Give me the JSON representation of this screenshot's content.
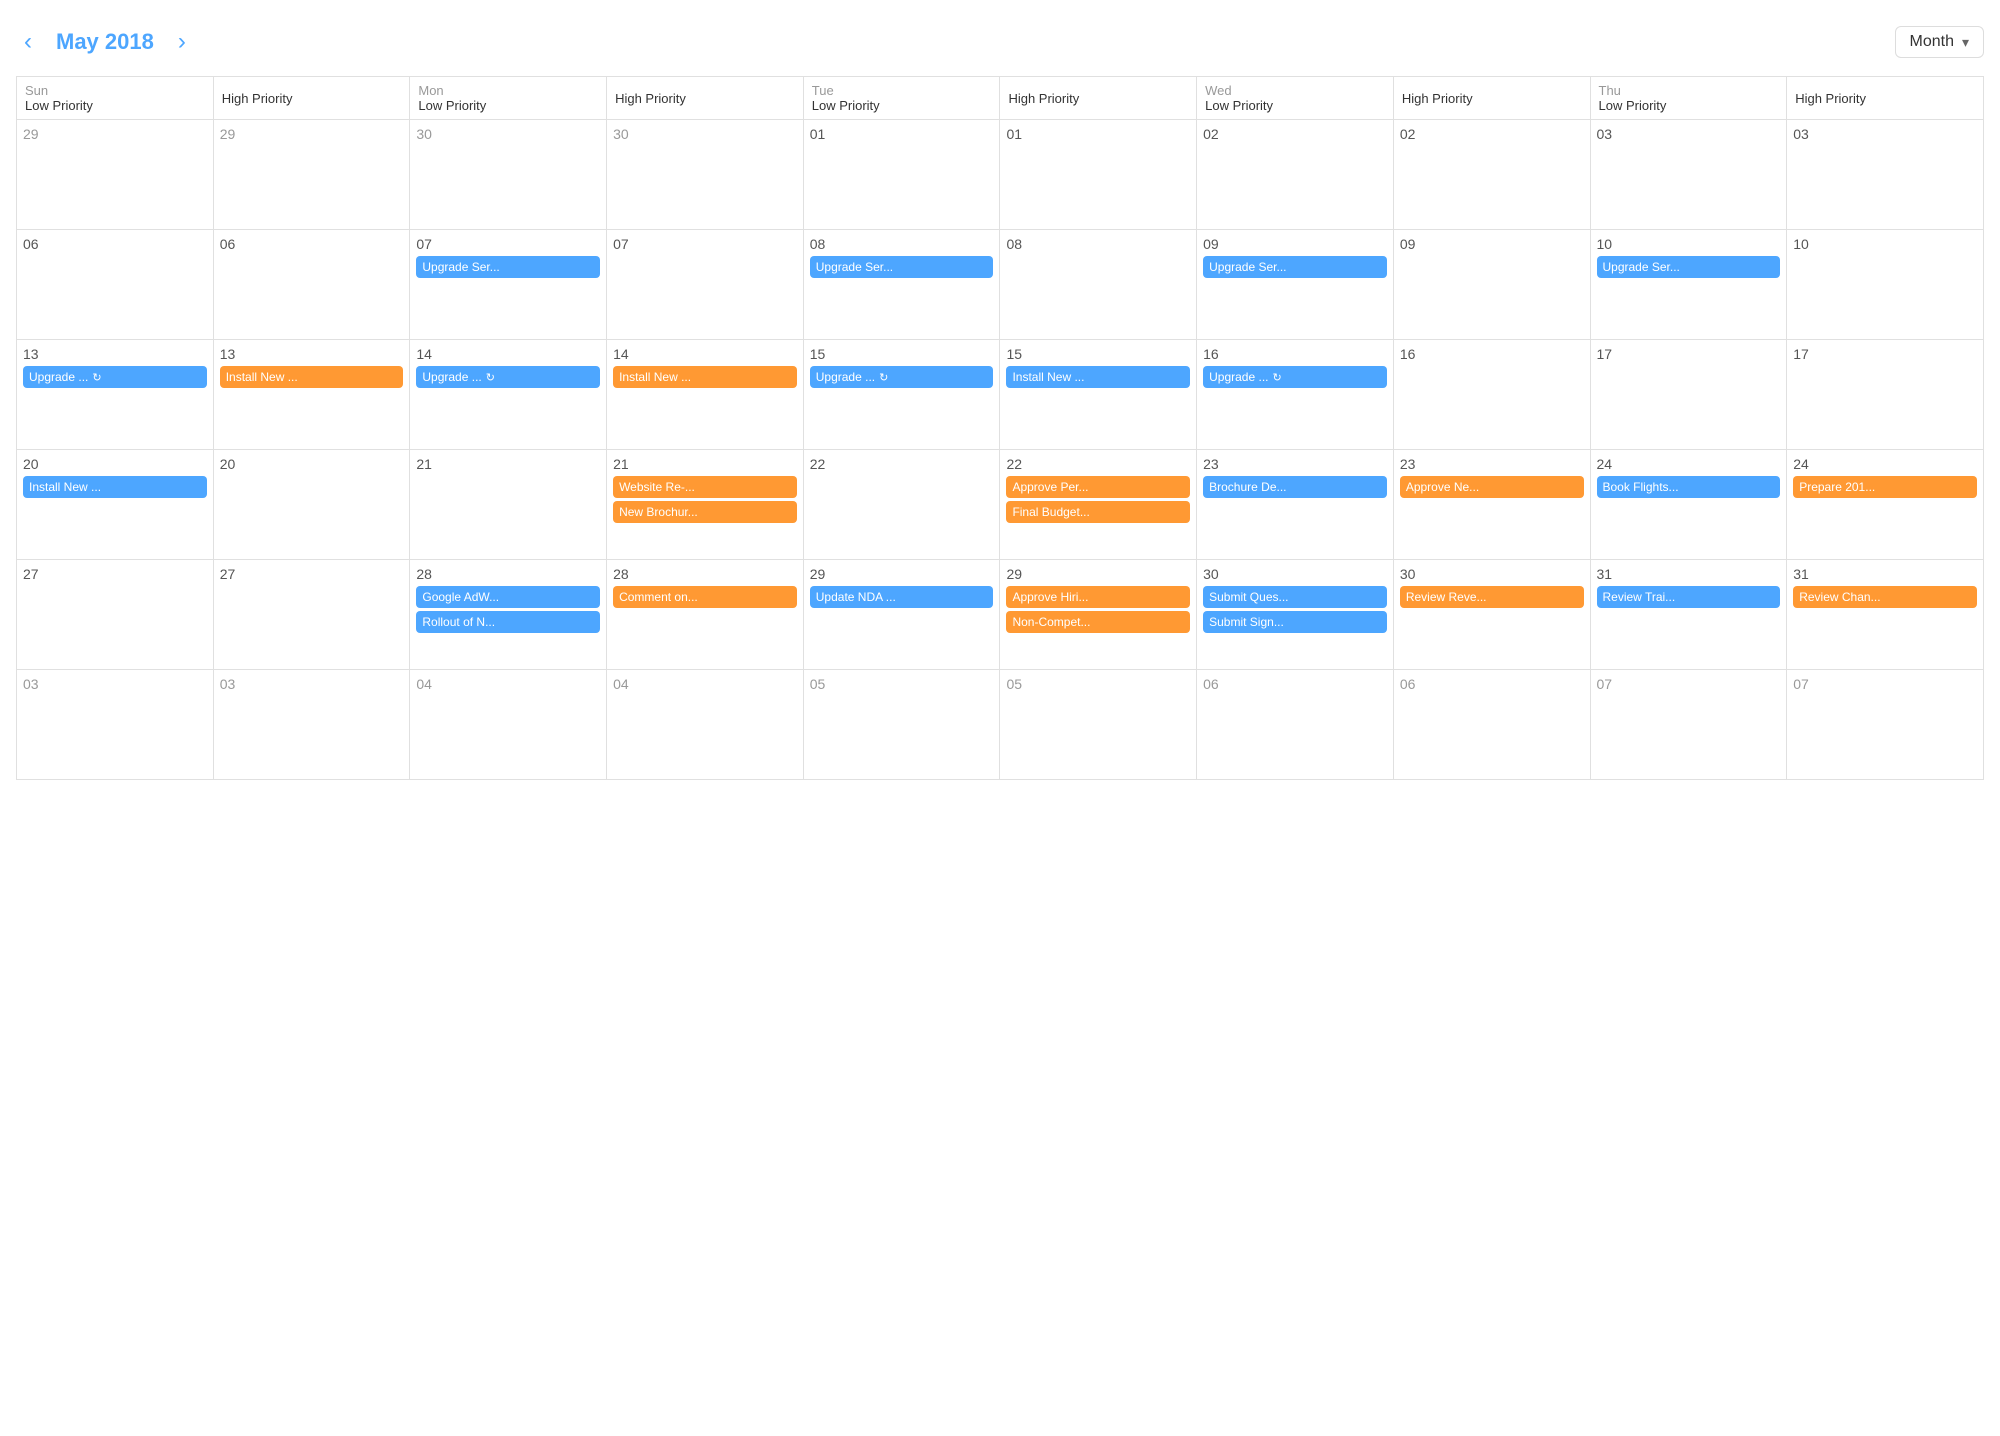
{
  "header": {
    "prev_label": "‹",
    "next_label": "›",
    "month_title": "May 2018",
    "view_label": "Month",
    "chevron": "▾"
  },
  "columns": [
    {
      "day": "Sun",
      "low": "Low Priority",
      "high": "High Priority"
    },
    {
      "day": "Mon",
      "low": "Low Priority",
      "high": "High Priority"
    },
    {
      "day": "Tue",
      "low": "Low Priority",
      "high": "High Priority"
    },
    {
      "day": "Wed",
      "low": "Low Priority",
      "high": "High Priority"
    },
    {
      "day": "Thu",
      "low": "Low Priority",
      "high": "High Priority"
    }
  ],
  "weeks": [
    {
      "cells": [
        {
          "date": "29",
          "in_month": false,
          "col": "sun-low",
          "events": []
        },
        {
          "date": "29",
          "in_month": false,
          "col": "sun-high",
          "events": []
        },
        {
          "date": "30",
          "in_month": false,
          "col": "mon-low",
          "events": []
        },
        {
          "date": "30",
          "in_month": false,
          "col": "mon-high",
          "events": []
        },
        {
          "date": "01",
          "in_month": true,
          "col": "tue-low",
          "events": []
        },
        {
          "date": "01",
          "in_month": true,
          "col": "tue-high",
          "events": []
        },
        {
          "date": "02",
          "in_month": true,
          "col": "wed-low",
          "events": []
        },
        {
          "date": "02",
          "in_month": true,
          "col": "wed-high",
          "events": []
        },
        {
          "date": "03",
          "in_month": true,
          "col": "thu-low",
          "events": []
        },
        {
          "date": "03",
          "in_month": true,
          "col": "thu-high",
          "events": []
        }
      ]
    },
    {
      "cells": [
        {
          "date": "06",
          "in_month": true,
          "col": "sun-low",
          "events": []
        },
        {
          "date": "06",
          "in_month": true,
          "col": "sun-high",
          "events": []
        },
        {
          "date": "07",
          "in_month": true,
          "col": "mon-low",
          "events": [
            {
              "text": "Upgrade Ser...",
              "color": "blue",
              "icon": false
            }
          ]
        },
        {
          "date": "07",
          "in_month": true,
          "col": "mon-high",
          "events": []
        },
        {
          "date": "08",
          "in_month": true,
          "col": "tue-low",
          "events": [
            {
              "text": "Upgrade Ser...",
              "color": "blue",
              "icon": false
            }
          ]
        },
        {
          "date": "08",
          "in_month": true,
          "col": "tue-high",
          "events": []
        },
        {
          "date": "09",
          "in_month": true,
          "col": "wed-low",
          "events": [
            {
              "text": "Upgrade Ser...",
              "color": "blue",
              "icon": false
            }
          ]
        },
        {
          "date": "09",
          "in_month": true,
          "col": "wed-high",
          "events": []
        },
        {
          "date": "10",
          "in_month": true,
          "col": "thu-low",
          "events": [
            {
              "text": "Upgrade Ser...",
              "color": "blue",
              "icon": false
            }
          ]
        },
        {
          "date": "10",
          "in_month": true,
          "col": "thu-high",
          "events": []
        }
      ]
    },
    {
      "cells": [
        {
          "date": "13",
          "in_month": true,
          "col": "sun-low",
          "events": [
            {
              "text": "Upgrade ...",
              "color": "blue",
              "icon": true
            }
          ]
        },
        {
          "date": "13",
          "in_month": true,
          "col": "sun-high",
          "events": [
            {
              "text": "Install New ...",
              "color": "orange",
              "icon": false
            }
          ]
        },
        {
          "date": "14",
          "in_month": true,
          "col": "mon-low",
          "events": [
            {
              "text": "Upgrade ...",
              "color": "blue",
              "icon": true
            }
          ]
        },
        {
          "date": "14",
          "in_month": true,
          "col": "mon-high",
          "events": [
            {
              "text": "Install New ...",
              "color": "orange",
              "icon": false
            }
          ]
        },
        {
          "date": "15",
          "in_month": true,
          "col": "tue-low",
          "events": [
            {
              "text": "Upgrade ...",
              "color": "blue",
              "icon": true
            }
          ]
        },
        {
          "date": "15",
          "in_month": true,
          "col": "tue-high",
          "events": [
            {
              "text": "Install New ...",
              "color": "blue",
              "icon": false
            }
          ]
        },
        {
          "date": "16",
          "in_month": true,
          "col": "wed-low",
          "events": [
            {
              "text": "Upgrade ...",
              "color": "blue",
              "icon": true
            }
          ]
        },
        {
          "date": "16",
          "in_month": true,
          "col": "wed-high",
          "events": []
        },
        {
          "date": "17",
          "in_month": true,
          "col": "thu-low",
          "events": []
        },
        {
          "date": "17",
          "in_month": true,
          "col": "thu-high",
          "events": []
        }
      ]
    },
    {
      "cells": [
        {
          "date": "20",
          "in_month": true,
          "col": "sun-low",
          "events": [
            {
              "text": "Install New ...",
              "color": "blue",
              "icon": false
            }
          ]
        },
        {
          "date": "20",
          "in_month": true,
          "col": "sun-high",
          "events": []
        },
        {
          "date": "21",
          "in_month": true,
          "col": "mon-low",
          "events": []
        },
        {
          "date": "21",
          "in_month": true,
          "col": "mon-high",
          "events": []
        },
        {
          "date": "21",
          "in_month": true,
          "col": "tue-low-21",
          "events": []
        },
        {
          "date": "21",
          "in_month": true,
          "col": "mon-high-21",
          "events": [
            {
              "text": "Website Re-...",
              "color": "orange",
              "icon": false
            },
            {
              "text": "New Brochur...",
              "color": "orange",
              "icon": false
            }
          ]
        },
        {
          "date": "22",
          "in_month": true,
          "col": "wed-low-22",
          "events": []
        },
        {
          "date": "22",
          "in_month": true,
          "col": "tue-high-22",
          "events": [
            {
              "text": "Approve Per...",
              "color": "orange",
              "icon": false
            },
            {
              "text": "Final Budget...",
              "color": "orange",
              "icon": false
            }
          ]
        },
        {
          "date": "23",
          "in_month": true,
          "col": "wed-low-23",
          "events": [
            {
              "text": "Brochure De...",
              "color": "blue",
              "icon": false
            }
          ]
        },
        {
          "date": "23",
          "in_month": true,
          "col": "wed-high-23",
          "events": [
            {
              "text": "Approve Ne...",
              "color": "orange",
              "icon": false
            }
          ]
        },
        {
          "date": "24",
          "in_month": true,
          "col": "thu-low-24",
          "events": [
            {
              "text": "Book Flights...",
              "color": "blue",
              "icon": false
            }
          ]
        },
        {
          "date": "24",
          "in_month": true,
          "col": "thu-high-24",
          "events": [
            {
              "text": "Prepare 201...",
              "color": "orange",
              "icon": false
            }
          ]
        }
      ]
    },
    {
      "cells": [
        {
          "date": "27",
          "in_month": true,
          "col": "sun-low",
          "events": []
        },
        {
          "date": "27",
          "in_month": true,
          "col": "sun-high",
          "events": []
        },
        {
          "date": "28",
          "in_month": true,
          "col": "mon-low",
          "events": [
            {
              "text": "Google AdW...",
              "color": "blue",
              "icon": false
            },
            {
              "text": "Rollout of N...",
              "color": "blue",
              "icon": false
            }
          ]
        },
        {
          "date": "28",
          "in_month": true,
          "col": "mon-high",
          "events": [
            {
              "text": "Comment on...",
              "color": "orange",
              "icon": false
            }
          ]
        },
        {
          "date": "29",
          "in_month": true,
          "col": "tue-low",
          "events": [
            {
              "text": "Update NDA ...",
              "color": "blue",
              "icon": false
            }
          ]
        },
        {
          "date": "29",
          "in_month": true,
          "col": "tue-high",
          "events": [
            {
              "text": "Approve Hiri...",
              "color": "orange",
              "icon": false
            },
            {
              "text": "Non-Compet...",
              "color": "orange",
              "icon": false
            }
          ]
        },
        {
          "date": "30",
          "in_month": true,
          "col": "wed-low",
          "events": [
            {
              "text": "Submit Ques...",
              "color": "blue",
              "icon": false
            },
            {
              "text": "Submit Sign...",
              "color": "blue",
              "icon": false
            }
          ]
        },
        {
          "date": "30",
          "in_month": true,
          "col": "wed-high",
          "events": [
            {
              "text": "Review Reve...",
              "color": "orange",
              "icon": false
            }
          ]
        },
        {
          "date": "31",
          "in_month": true,
          "col": "thu-low",
          "events": [
            {
              "text": "Review Trai...",
              "color": "blue",
              "icon": false
            }
          ]
        },
        {
          "date": "31",
          "in_month": true,
          "col": "thu-high",
          "events": [
            {
              "text": "Review Chan...",
              "color": "orange",
              "icon": false
            }
          ]
        }
      ]
    },
    {
      "cells": [
        {
          "date": "03",
          "in_month": false,
          "col": "sun-low",
          "events": []
        },
        {
          "date": "03",
          "in_month": false,
          "col": "sun-high",
          "events": []
        },
        {
          "date": "04",
          "in_month": false,
          "col": "mon-low",
          "events": []
        },
        {
          "date": "04",
          "in_month": false,
          "col": "mon-high",
          "events": []
        },
        {
          "date": "05",
          "in_month": false,
          "col": "tue-low",
          "events": []
        },
        {
          "date": "05",
          "in_month": false,
          "col": "tue-high",
          "events": []
        },
        {
          "date": "06",
          "in_month": false,
          "col": "wed-low",
          "events": []
        },
        {
          "date": "06",
          "in_month": false,
          "col": "wed-high",
          "events": []
        },
        {
          "date": "07",
          "in_month": false,
          "col": "thu-low",
          "events": []
        },
        {
          "date": "07",
          "in_month": false,
          "col": "thu-high",
          "events": []
        }
      ]
    }
  ]
}
